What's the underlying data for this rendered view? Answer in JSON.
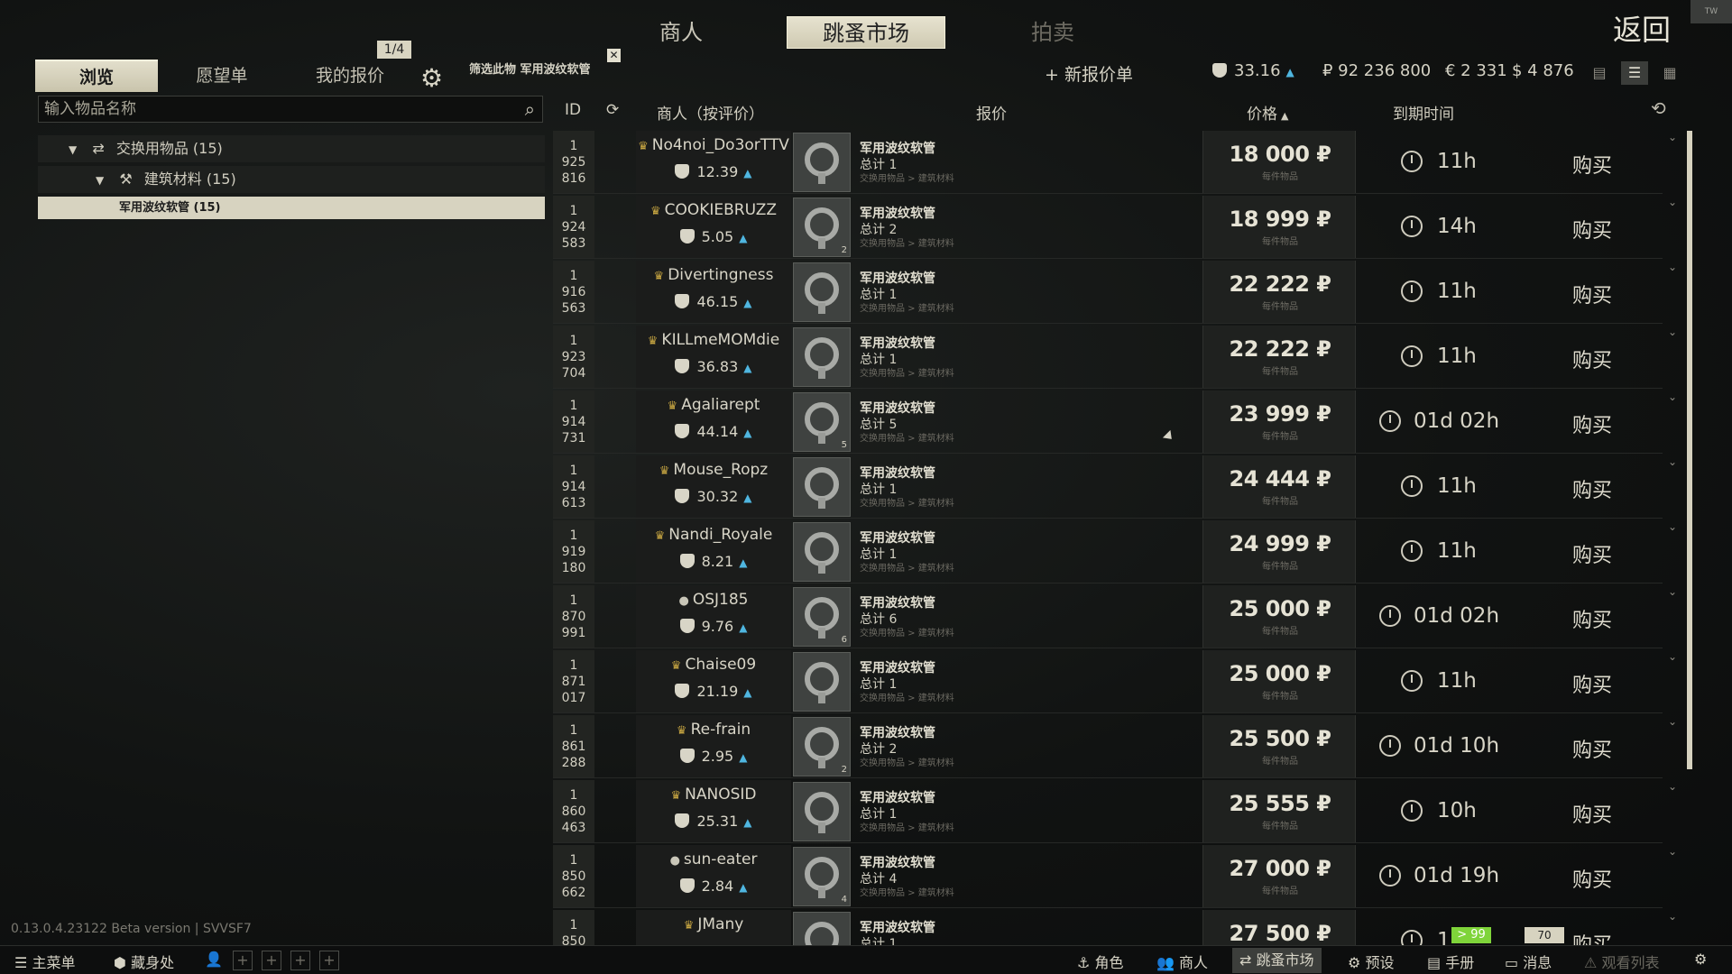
{
  "top_tabs": [
    "商人",
    "跳蚤市场",
    "拍卖"
  ],
  "back_label": "返回",
  "corner_badge": "TW",
  "sub_tabs": [
    "浏览",
    "愿望单",
    "我的报价"
  ],
  "page_indicator": "1/4",
  "filter_label": "筛选此物 军用波纹软管",
  "search": {
    "placeholder": "输入物品名称"
  },
  "tree": {
    "category": "交换用物品 (15)",
    "subcategory": "建筑材料 (15)",
    "selected_item": "军用波纹软管 (15)"
  },
  "header_info": {
    "new_offer": "+ 新报价单",
    "rating": "33.16",
    "rubles": "₽ 92 236 800",
    "euros": "€ 2 331",
    "dollars": "$ 4 876"
  },
  "columns": {
    "id": "ID",
    "merchant": "商人（按评价）",
    "offer": "报价",
    "price": "价格",
    "expiry": "到期时间"
  },
  "offers": [
    {
      "id": [
        "1",
        "925",
        "816"
      ],
      "merchant": "No4noi_Do3orTTV",
      "type": "crown",
      "rating": "12.39",
      "item": "军用波纹软管",
      "count": "总计 1",
      "qty": "",
      "category": "交换用物品 > 建筑材料",
      "price": "18 000 ₽",
      "per": "每件物品",
      "time": "11h",
      "buy": "购买"
    },
    {
      "id": [
        "1",
        "924",
        "583"
      ],
      "merchant": "COOKIEBRUZZ",
      "type": "crown",
      "rating": "5.05",
      "item": "军用波纹软管",
      "count": "总计 2",
      "qty": "2",
      "category": "交换用物品 > 建筑材料",
      "price": "18 999 ₽",
      "per": "每件物品",
      "time": "14h",
      "buy": "购买"
    },
    {
      "id": [
        "1",
        "916",
        "563"
      ],
      "merchant": "Divertingness",
      "type": "crown",
      "rating": "46.15",
      "item": "军用波纹软管",
      "count": "总计 1",
      "qty": "",
      "category": "交换用物品 > 建筑材料",
      "price": "22 222 ₽",
      "per": "每件物品",
      "time": "11h",
      "buy": "购买"
    },
    {
      "id": [
        "1",
        "923",
        "704"
      ],
      "merchant": "KILLmeMOMdie",
      "type": "crown",
      "rating": "36.83",
      "item": "军用波纹软管",
      "count": "总计 1",
      "qty": "",
      "category": "交换用物品 > 建筑材料",
      "price": "22 222 ₽",
      "per": "每件物品",
      "time": "11h",
      "buy": "购买"
    },
    {
      "id": [
        "1",
        "914",
        "731"
      ],
      "merchant": "Agaliarept",
      "type": "crown",
      "rating": "44.14",
      "item": "军用波纹软管",
      "count": "总计 5",
      "qty": "5",
      "category": "交换用物品 > 建筑材料",
      "price": "23 999 ₽",
      "per": "每件物品",
      "time": "01d 02h",
      "buy": "购买"
    },
    {
      "id": [
        "1",
        "914",
        "613"
      ],
      "merchant": "Mouse_Ropz",
      "type": "crown",
      "rating": "30.32",
      "item": "军用波纹软管",
      "count": "总计 1",
      "qty": "",
      "category": "交换用物品 > 建筑材料",
      "price": "24 444 ₽",
      "per": "每件物品",
      "time": "11h",
      "buy": "购买"
    },
    {
      "id": [
        "1",
        "919",
        "180"
      ],
      "merchant": "Nandi_Royale",
      "type": "crown",
      "rating": "8.21",
      "item": "军用波纹软管",
      "count": "总计 1",
      "qty": "",
      "category": "交换用物品 > 建筑材料",
      "price": "24 999 ₽",
      "per": "每件物品",
      "time": "11h",
      "buy": "购买"
    },
    {
      "id": [
        "1",
        "870",
        "991"
      ],
      "merchant": "OSJ185",
      "type": "person",
      "rating": "9.76",
      "item": "军用波纹软管",
      "count": "总计 6",
      "qty": "6",
      "category": "交换用物品 > 建筑材料",
      "price": "25 000 ₽",
      "per": "每件物品",
      "time": "01d 02h",
      "buy": "购买"
    },
    {
      "id": [
        "1",
        "871",
        "017"
      ],
      "merchant": "Chaise09",
      "type": "crown",
      "rating": "21.19",
      "item": "军用波纹软管",
      "count": "总计 1",
      "qty": "",
      "category": "交换用物品 > 建筑材料",
      "price": "25 000 ₽",
      "per": "每件物品",
      "time": "11h",
      "buy": "购买"
    },
    {
      "id": [
        "1",
        "861",
        "288"
      ],
      "merchant": "Re-frain",
      "type": "crown",
      "rating": "2.95",
      "item": "军用波纹软管",
      "count": "总计 2",
      "qty": "2",
      "category": "交换用物品 > 建筑材料",
      "price": "25 500 ₽",
      "per": "每件物品",
      "time": "01d 10h",
      "buy": "购买"
    },
    {
      "id": [
        "1",
        "860",
        "463"
      ],
      "merchant": "NANOSID",
      "type": "crown",
      "rating": "25.31",
      "item": "军用波纹软管",
      "count": "总计 1",
      "qty": "",
      "category": "交换用物品 > 建筑材料",
      "price": "25 555 ₽",
      "per": "每件物品",
      "time": "10h",
      "buy": "购买"
    },
    {
      "id": [
        "1",
        "850",
        "662"
      ],
      "merchant": "sun-eater",
      "type": "person",
      "rating": "2.84",
      "item": "军用波纹软管",
      "count": "总计 4",
      "qty": "4",
      "category": "交换用物品 > 建筑材料",
      "price": "27 000 ₽",
      "per": "每件物品",
      "time": "01d 19h",
      "buy": "购买"
    },
    {
      "id": [
        "1",
        "850",
        ""
      ],
      "merchant": "JMany",
      "type": "crown",
      "rating": "",
      "item": "军用波纹软管",
      "count": "总计 1",
      "qty": "",
      "category": "",
      "price": "27 500 ₽",
      "per": "",
      "time": "1",
      "buy": "购买"
    }
  ],
  "version": "0.13.0.4.23122 Beta version | SVVSF7",
  "bottom_bar": {
    "main_menu": "主菜单",
    "hideout": "藏身处",
    "character": "角色",
    "traders": "商人",
    "flea": "跳蚤市场",
    "presets": "预设",
    "handbook": "手册",
    "messages": "消息",
    "watchlist": "观看列表"
  },
  "badges": {
    "green": "> 99",
    "gray": "70"
  }
}
